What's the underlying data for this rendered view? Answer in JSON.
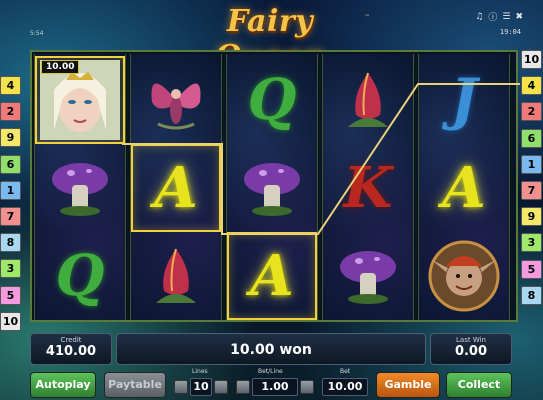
{
  "game": {
    "title": "Fairy Queen",
    "trademark": "™",
    "counter": "5:54",
    "time": "19:04",
    "status_icons": [
      "music-icon",
      "info-icon",
      "menu-icon",
      "close-icon"
    ]
  },
  "line_tabs_left": [
    {
      "label": "4",
      "color": "#f3e24a"
    },
    {
      "label": "2",
      "color": "#f07a7a"
    },
    {
      "label": "9",
      "color": "#f4e86a"
    },
    {
      "label": "6",
      "color": "#8ee06a"
    },
    {
      "label": "1",
      "color": "#7ab8f0"
    },
    {
      "label": "7",
      "color": "#f28f8f"
    },
    {
      "label": "8",
      "color": "#a8d8f0"
    },
    {
      "label": "3",
      "color": "#9ee86a"
    },
    {
      "label": "5",
      "color": "#f49ae0"
    },
    {
      "label": "10",
      "color": "#e8e8e8"
    }
  ],
  "line_tabs_right": [
    {
      "label": "10",
      "color": "#e8e8e8"
    },
    {
      "label": "4",
      "color": "#f3e24a"
    },
    {
      "label": "2",
      "color": "#f07a7a"
    },
    {
      "label": "6",
      "color": "#8ee06a"
    },
    {
      "label": "1",
      "color": "#7ab8f0"
    },
    {
      "label": "7",
      "color": "#f28f8f"
    },
    {
      "label": "9",
      "color": "#f4e86a"
    },
    {
      "label": "3",
      "color": "#9ee86a"
    },
    {
      "label": "5",
      "color": "#f49ae0"
    },
    {
      "label": "8",
      "color": "#a8d8f0"
    }
  ],
  "reels": [
    [
      "queen",
      "mushroom",
      "Q"
    ],
    [
      "fairy",
      "A",
      "flower"
    ],
    [
      "Q",
      "mushroom",
      "A"
    ],
    [
      "flower",
      "K",
      "mushroom"
    ],
    [
      "J",
      "A",
      "elf"
    ]
  ],
  "winning_symbol_value": "10.00",
  "panel": {
    "credit_label": "Credit",
    "credit_value": "410.00",
    "message": "10.00 won",
    "last_win_label": "Last Win",
    "last_win_value": "0.00",
    "lines_label": "Lines",
    "lines_value": "10",
    "bet_line_label": "Bet/Line",
    "bet_line_value": "1.00",
    "bet_label": "Bet",
    "bet_value": "10.00"
  },
  "buttons": {
    "autoplay": "Autoplay",
    "paytable": "Paytable",
    "gamble": "Gamble",
    "collect": "Collect"
  },
  "colors": {
    "title_gold": "#f4c34a",
    "win_frame": "#f1d23a",
    "win_line": "#e8d27a"
  }
}
